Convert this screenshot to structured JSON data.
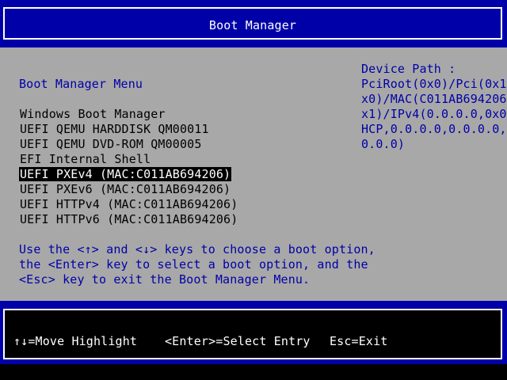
{
  "header": {
    "title": "Boot Manager"
  },
  "menu": {
    "title": "Boot Manager Menu",
    "items": [
      {
        "label": "Windows Boot Manager",
        "selected": false
      },
      {
        "label": "UEFI QEMU HARDDISK QM00011",
        "selected": false
      },
      {
        "label": "UEFI QEMU DVD-ROM QM00005",
        "selected": false
      },
      {
        "label": "EFI Internal Shell",
        "selected": false
      },
      {
        "label": "UEFI PXEv4 (MAC:C011AB694206)",
        "selected": true
      },
      {
        "label": "UEFI PXEv6 (MAC:C011AB694206)",
        "selected": false
      },
      {
        "label": "UEFI HTTPv4 (MAC:C011AB694206)",
        "selected": false
      },
      {
        "label": "UEFI HTTPv6 (MAC:C011AB694206)",
        "selected": false
      }
    ]
  },
  "help": {
    "lines": [
      "Use the <↑> and <↓> keys to choose a boot option,",
      "the <Enter> key to select a boot option, and the",
      "<Esc> key to exit the Boot Manager Menu."
    ]
  },
  "device_path": {
    "heading": "Device Path :",
    "lines": [
      "PciRoot(0x0)/Pci(0x1,0",
      "x0)/MAC(C011AB694206,0",
      "x1)/IPv4(0.0.0.0,0x0,D",
      "HCP,0.0.0.0,0.0.0.0,0.",
      "0.0.0)"
    ]
  },
  "footer": {
    "move_highlight": "↑↓=Move Highlight",
    "select_entry": "<Enter>=Select Entry",
    "exit": "Esc=Exit"
  },
  "colors": {
    "bios_blue": "#0000a8",
    "panel_gray": "#a8a8a8",
    "highlight_bg": "#000000",
    "highlight_fg": "#ffffff"
  }
}
